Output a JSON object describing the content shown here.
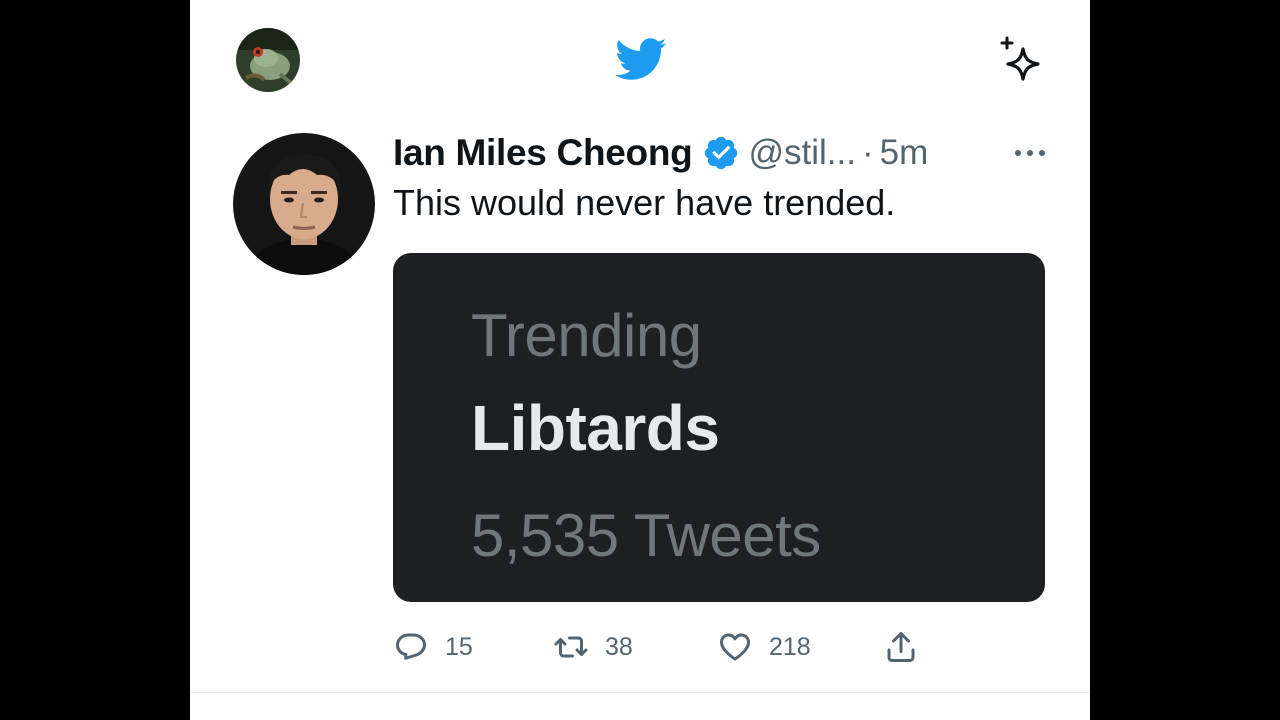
{
  "header": {
    "logo": "twitter-bird-icon",
    "accent_color": "#1d9bf0",
    "sparkle_icon": "sparkle-icon",
    "profile_avatar": "frog-avatar"
  },
  "tweet": {
    "author_name": "Ian Miles Cheong",
    "verified": true,
    "handle": "@stil...",
    "separator": "·",
    "time": "5m",
    "text": "This would never have trended.",
    "media": {
      "trending_label": "Trending",
      "topic": "Libtards",
      "tweet_count": "5,535 Tweets"
    },
    "actions": {
      "replies": "15",
      "retweets": "38",
      "likes": "218"
    }
  }
}
